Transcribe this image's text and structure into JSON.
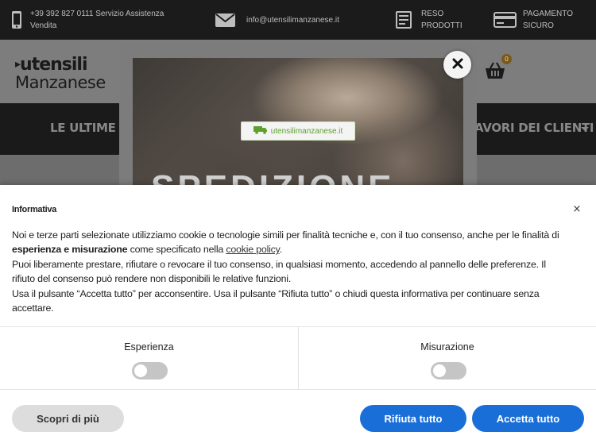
{
  "topbar": {
    "phone_text_line1": "+39 392 827 0111 Servizio Assistenza",
    "phone_text_line2": "Vendita",
    "email_text": "info@utensilimanzanese.it",
    "returns_line1": "RESO",
    "returns_line2": "PRODOTTI",
    "payment_line1": "PAGAMENTO",
    "payment_line2": "SICURO"
  },
  "header": {
    "logo_line1": "utensili",
    "logo_line2": "Manzanese",
    "cart_count": "0"
  },
  "nav": {
    "item_left": "LE ULTIME NO",
    "item_right": "AVORI DEI CLIENTI"
  },
  "popup": {
    "badge_text": "utensilimanzanese.it",
    "big_text": "SPEDIZIONE"
  },
  "cookie": {
    "title": "Informativa",
    "close_glyph": "×",
    "p1_pre": "Noi e terze parti selezionate utilizziamo cookie o tecnologie simili per finalità tecniche e, con il tuo consenso, anche per le finalità di ",
    "p1_bold": "esperienza e misurazione",
    "p1_mid": " come specificato nella ",
    "p1_link": "cookie policy",
    "p1_end": ".",
    "p2": "Puoi liberamente prestare, rifiutare o revocare il tuo consenso, in qualsiasi momento, accedendo al pannello delle preferenze. Il rifiuto del consenso può rendere non disponibili le relative funzioni.",
    "p3": "Usa il pulsante “Accetta tutto” per acconsentire. Usa il pulsante “Rifiuta tutto” o chiudi questa informativa per continuare senza accettare.",
    "pref_experience": "Esperienza",
    "pref_measurement": "Misurazione",
    "btn_more": "Scopri di più",
    "btn_reject": "Rifiuta tutto",
    "btn_accept": "Accetta tutto"
  },
  "colors": {
    "primary_button": "#1a6ed8",
    "badge_green": "#5da02c"
  }
}
